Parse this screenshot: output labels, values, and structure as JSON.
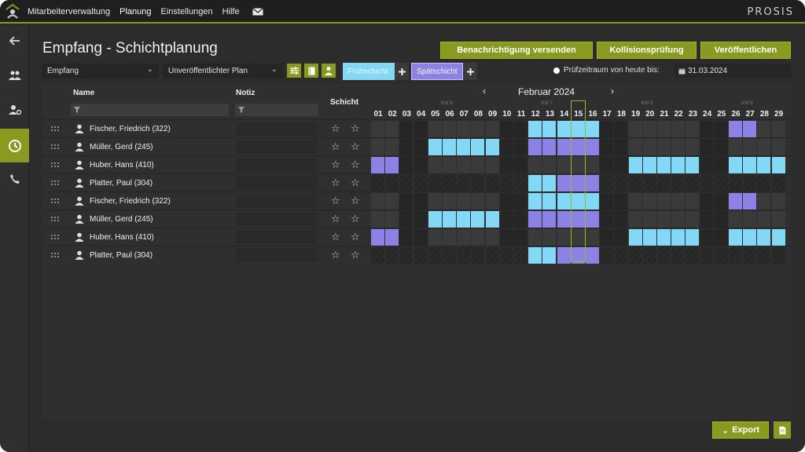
{
  "brand": "PROSIS",
  "nav": {
    "items": [
      "Mitarbeiterverwaltung",
      "Planung",
      "Einstellungen",
      "Hilfe"
    ],
    "active": "Planung"
  },
  "sidebar": {
    "items": [
      {
        "name": "back-arrow-icon",
        "active": false
      },
      {
        "name": "team-icon",
        "active": false
      },
      {
        "name": "user-settings-icon",
        "active": false
      },
      {
        "name": "schedule-icon",
        "active": true
      },
      {
        "name": "phone-icon",
        "active": false
      }
    ]
  },
  "page": {
    "title": "Empfang - Schichtplanung",
    "buttons": {
      "notify": "Benachrichtigung versenden",
      "collision": "Kollisionsprüfung",
      "publish": "Veröffentlichen"
    }
  },
  "toolbar": {
    "location": "Empfang",
    "plan": "Unveröffentlichter Plan",
    "shift_early": "Frühschicht",
    "shift_late": "Spätschicht",
    "check_label": "Prüfzeitraum von heute bis:",
    "check_date": "31.03.2024"
  },
  "colors": {
    "accent": "#8a9a20",
    "early": "#82d8f5",
    "late": "#8c82e6",
    "weekend": "#262626",
    "weekday": "#3a3a3a"
  },
  "table": {
    "headers": {
      "name": "Name",
      "notiz": "Notiz",
      "schicht": "Schicht"
    },
    "month": "Februar 2024",
    "week_labels": [
      "KW 6",
      "KW 7",
      "KW 8",
      "KW 9"
    ],
    "days": [
      "01",
      "02",
      "03",
      "04",
      "05",
      "06",
      "07",
      "08",
      "09",
      "10",
      "11",
      "12",
      "13",
      "14",
      "15",
      "16",
      "17",
      "18",
      "19",
      "20",
      "21",
      "22",
      "23",
      "24",
      "25",
      "26",
      "27",
      "28",
      "29"
    ],
    "weekend_days": [
      3,
      4,
      10,
      11,
      17,
      18,
      24,
      25
    ],
    "today": 15,
    "rows": [
      {
        "name": "Fischer, Friedrich (322)",
        "shifts": {
          "12": "F",
          "13": "F",
          "14": "F",
          "15": "F",
          "16": "F",
          "26": "S",
          "27": "S"
        }
      },
      {
        "name": "Müller, Gerd (245)",
        "shifts": {
          "05": "F",
          "06": "F",
          "07": "F",
          "08": "F",
          "09": "F",
          "12": "S",
          "13": "S",
          "14": "S",
          "15": "S",
          "16": "S"
        }
      },
      {
        "name": "Huber, Hans (410)",
        "shifts": {
          "01": "S",
          "02": "S",
          "19": "F",
          "20": "F",
          "21": "F",
          "22": "F",
          "23": "F",
          "26": "F",
          "27": "F",
          "28": "F",
          "29": "F"
        }
      },
      {
        "name": "Platter, Paul (304)",
        "absent": true,
        "shifts": {
          "12": "F",
          "13": "F",
          "14": "S",
          "15": "S",
          "16": "S"
        }
      },
      {
        "name": "Fischer, Friedrich (322)",
        "shifts": {
          "12": "F",
          "13": "F",
          "14": "F",
          "15": "F",
          "16": "F",
          "26": "S",
          "27": "S"
        }
      },
      {
        "name": "Müller, Gerd (245)",
        "shifts": {
          "05": "F",
          "06": "F",
          "07": "F",
          "08": "F",
          "09": "F",
          "12": "S",
          "13": "S",
          "14": "S",
          "15": "S",
          "16": "S"
        }
      },
      {
        "name": "Huber, Hans (410)",
        "shifts": {
          "01": "S",
          "02": "S",
          "19": "F",
          "20": "F",
          "21": "F",
          "22": "F",
          "23": "F",
          "26": "F",
          "27": "F",
          "28": "F",
          "29": "F"
        }
      },
      {
        "name": "Platter, Paul (304)",
        "absent": true,
        "shifts": {
          "12": "F",
          "13": "F",
          "14": "S",
          "15": "S",
          "16": "S"
        }
      }
    ]
  },
  "footer": {
    "export": "Export"
  }
}
